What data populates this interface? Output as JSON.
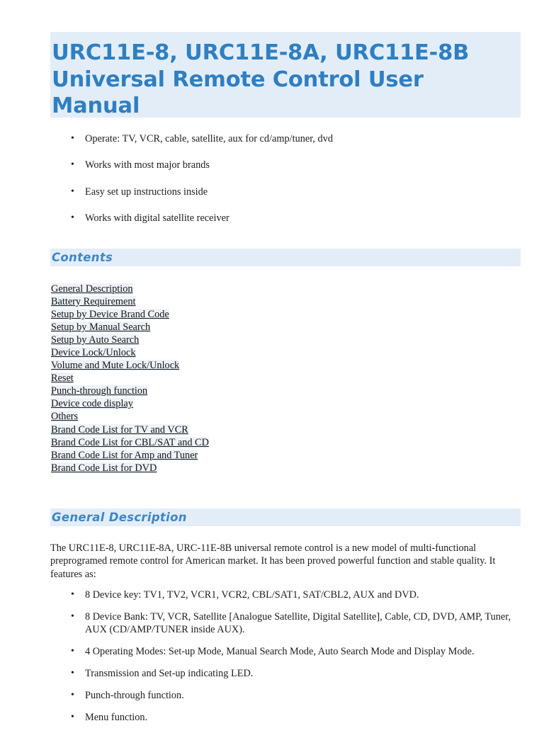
{
  "document": {
    "title": "URC11E-8, URC11E-8A, URC11E-8B Universal Remote Control User Manual",
    "accent_color": "#2f7fc1",
    "band_color": "#e3edf7",
    "body_color": "#1c1c1c"
  },
  "features": [
    "Operate: TV, VCR, cable, satellite, aux for cd/amp/tuner, dvd",
    "Works with most major brands",
    "Easy set up instructions inside",
    "Works with digital satellite receiver"
  ],
  "contents": {
    "heading": "Contents",
    "links": [
      "General Description",
      "Battery Requirement",
      "Setup by Device Brand Code",
      "Setup by Manual Search",
      "Setup by Auto Search",
      "Device Lock/Unlock",
      "Volume and Mute Lock/Unlock",
      "Reset",
      "Punch-through function",
      "Device code display",
      "Others",
      "Brand Code List for TV and VCR",
      "Brand Code List for CBL/SAT and CD",
      "Brand Code List for Amp and Tuner",
      "Brand Code List for DVD"
    ]
  },
  "general_description": {
    "heading": "General Description",
    "paragraph": "The URC11E-8, URC11E-8A, URC-11E-8B universal remote control is a new model of multi-functional preprogramed remote control for American market. It has been proved powerful function and stable quality. It features as:",
    "bullets": [
      "8 Device key: TV1, TV2, VCR1, VCR2, CBL/SAT1, SAT/CBL2, AUX and DVD.",
      "8 Device Bank: TV, VCR, Satellite [Analogue Satellite, Digital Satellite], Cable, CD, DVD, AMP, Tuner, AUX (CD/AMP/TUNER inside AUX).",
      "4 Operating Modes: Set-up Mode, Manual Search Mode, Auto Search Mode and Display Mode.",
      "Transmission and Set-up indicating LED.",
      "Punch-through function.",
      "Menu function."
    ]
  }
}
